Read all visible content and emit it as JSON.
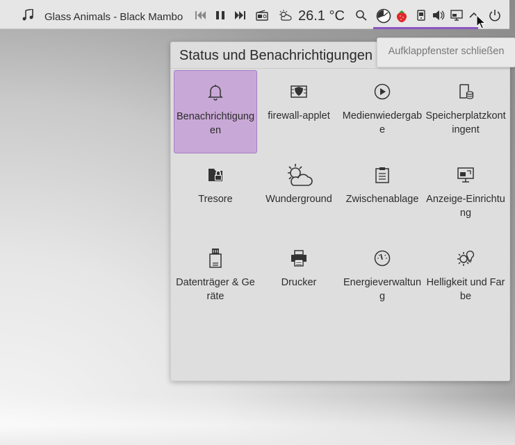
{
  "panel": {
    "track_title": "Glass Animals - Black Mambo",
    "temperature": "26.1 °C",
    "icons": [
      "music-note-icon",
      "previous-track-icon",
      "pause-icon",
      "next-track-icon",
      "radio-icon",
      "weather-icon",
      "search-icon",
      "activity-icon",
      "strawberry-icon",
      "storage-device-icon",
      "volume-icon",
      "display-icon",
      "chevron-up-icon",
      "power-icon"
    ]
  },
  "popup": {
    "title": "Status und Benachrichtigungen",
    "items": [
      {
        "label": "Benachrichtigungen",
        "icon": "bell-icon",
        "active": true
      },
      {
        "label": "firewall-applet",
        "icon": "firewall-icon"
      },
      {
        "label": "Medienwiedergabe",
        "icon": "play-circle-icon"
      },
      {
        "label": "Speicherplatzkontingent",
        "icon": "disk-quota-icon"
      },
      {
        "label": "Tresore",
        "icon": "vault-icon"
      },
      {
        "label": "Wunderground",
        "icon": "weather-cloud-icon"
      },
      {
        "label": "Zwischenablage",
        "icon": "clipboard-icon"
      },
      {
        "label": "Anzeige-Einrichtung",
        "icon": "display-config-icon"
      },
      {
        "label": "Datenträger & Geräte",
        "icon": "usb-drive-icon"
      },
      {
        "label": "Drucker",
        "icon": "printer-icon"
      },
      {
        "label": "Energieverwaltung",
        "icon": "gauge-icon"
      },
      {
        "label": "Helligkeit und Farbe",
        "icon": "brightness-icon"
      }
    ]
  },
  "tooltip": {
    "text": "Aufklappfenster schließen"
  },
  "colors": {
    "accent": "#8a56c2",
    "active_tile": "#c8a8d6"
  }
}
